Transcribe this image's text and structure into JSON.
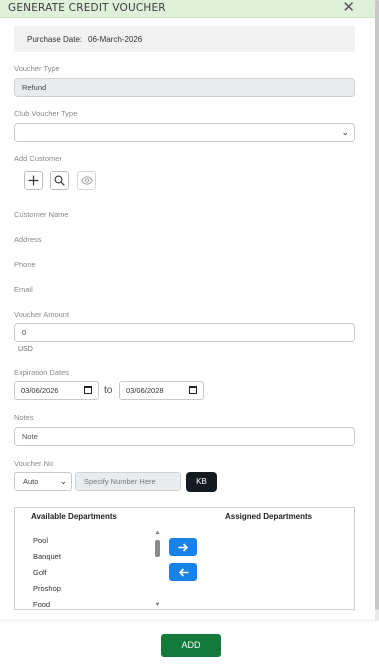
{
  "header": {
    "title": "GENERATE CREDIT VOUCHER",
    "close_icon": "close-icon"
  },
  "purchase": {
    "label": "Purchase Date:",
    "value": "06-March-2026"
  },
  "voucher_type": {
    "label": "Voucher Type",
    "value": "Refund"
  },
  "club_voucher_type": {
    "label": "Club Voucher Type",
    "value": ""
  },
  "add_customer": {
    "label": "Add Customer",
    "icons": [
      "plus-icon",
      "search-icon",
      "eye-icon"
    ]
  },
  "customer": {
    "name_label": "Customer Name",
    "address_label": "Address",
    "phone_label": "Phone",
    "email_label": "Email"
  },
  "voucher_amount": {
    "label": "Voucher Amount",
    "value": "0",
    "unit": "USD"
  },
  "expiration": {
    "label": "Expiration Dates",
    "from": "03/06/2026",
    "to_label": "to",
    "to": "03/06/2028"
  },
  "notes": {
    "label": "Notes",
    "placeholder": "Note"
  },
  "voucher_no": {
    "label": "Voucher No",
    "mode": "Auto",
    "placeholder": "Specify Number Here",
    "kb_label": "KB"
  },
  "departments": {
    "available_label": "Available Departments",
    "assigned_label": "Assigned Departments",
    "available": [
      "Pool",
      "Banquet",
      "Golf",
      "Proshop",
      "Food"
    ],
    "assigned": []
  },
  "footer": {
    "add_label": "ADD"
  },
  "colors": {
    "header_bg": "#dff0d8",
    "add_button": "#137a3b",
    "arrow_button": "#1683e8",
    "kb_button": "#151a21"
  }
}
